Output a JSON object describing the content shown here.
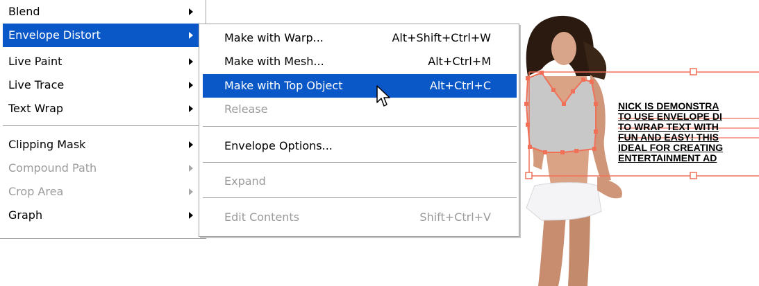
{
  "object_menu": {
    "items": [
      {
        "label": "Blend",
        "has_submenu": true,
        "enabled": true,
        "highlighted": false
      },
      {
        "label": "Envelope Distort",
        "has_submenu": true,
        "enabled": true,
        "highlighted": true
      },
      {
        "label": "Live Paint",
        "has_submenu": true,
        "enabled": true,
        "highlighted": false
      },
      {
        "label": "Live Trace",
        "has_submenu": true,
        "enabled": true,
        "highlighted": false
      },
      {
        "label": "Text Wrap",
        "has_submenu": true,
        "enabled": true,
        "highlighted": false
      },
      {
        "label": "Clipping Mask",
        "has_submenu": true,
        "enabled": true,
        "highlighted": false
      },
      {
        "label": "Compound Path",
        "has_submenu": true,
        "enabled": false,
        "highlighted": false
      },
      {
        "label": "Crop Area",
        "has_submenu": true,
        "enabled": false,
        "highlighted": false
      },
      {
        "label": "Graph",
        "has_submenu": true,
        "enabled": true,
        "highlighted": false
      }
    ]
  },
  "envelope_submenu": {
    "items": [
      {
        "label": "Make with Warp...",
        "shortcut": "Alt+Shift+Ctrl+W",
        "enabled": true,
        "highlighted": false
      },
      {
        "label": "Make with Mesh...",
        "shortcut": "Alt+Ctrl+M",
        "enabled": true,
        "highlighted": false
      },
      {
        "label": "Make with Top Object",
        "shortcut": "Alt+Ctrl+C",
        "enabled": true,
        "highlighted": true
      },
      {
        "label": "Release",
        "shortcut": "",
        "enabled": false,
        "highlighted": false
      },
      {
        "label": "Envelope Options...",
        "shortcut": "",
        "enabled": true,
        "highlighted": false
      },
      {
        "label": "Expand",
        "shortcut": "",
        "enabled": false,
        "highlighted": false
      },
      {
        "label": "Edit Contents",
        "shortcut": "Shift+Ctrl+V",
        "enabled": false,
        "highlighted": false
      }
    ]
  },
  "artwork": {
    "text_lines": [
      "NICK IS DEMONSTRA",
      "TO USE ENVELOPE DI",
      "TO WRAP TEXT WITH",
      "FUN AND EASY! THIS",
      "IDEAL FOR CREATING",
      "ENTERTAINMENT AD"
    ],
    "selection_color": "#f07058",
    "shape_fill": "#c8c8c8"
  },
  "colors": {
    "menu_highlight": "#0a58c8",
    "disabled_text": "#9a9a9a"
  }
}
